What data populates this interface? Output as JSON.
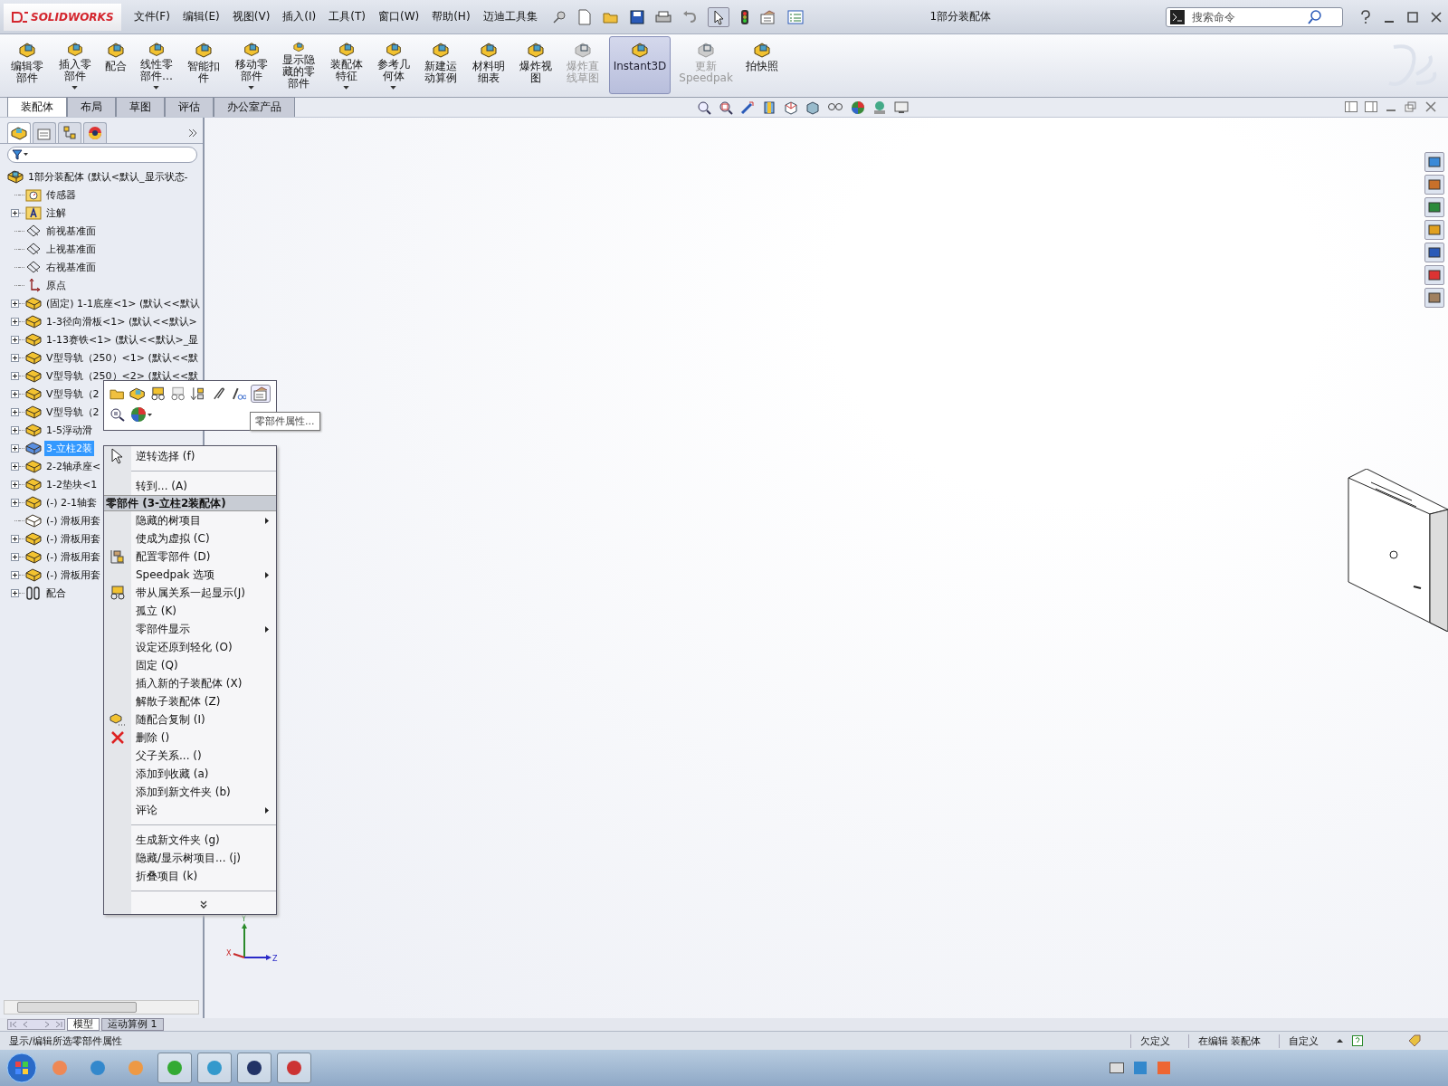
{
  "window": {
    "logo": "SOLIDWORKS",
    "title": "1部分装配体"
  },
  "menu_bar": [
    "文件(F)",
    "编辑(E)",
    "视图(V)",
    "插入(I)",
    "工具(T)",
    "窗口(W)",
    "帮助(H)",
    "迈迪工具集"
  ],
  "search": {
    "placeholder": "搜索命令"
  },
  "ribbon": [
    {
      "label": "编辑零部件",
      "dropdown": false,
      "disabled": false,
      "selected": false
    },
    {
      "label": "插入零部件",
      "dropdown": true,
      "disabled": false,
      "selected": false
    },
    {
      "label": "配合",
      "dropdown": false,
      "disabled": false,
      "selected": false
    },
    {
      "label": "线性零部件…",
      "dropdown": true,
      "disabled": false,
      "selected": false
    },
    {
      "label": "智能扣件",
      "dropdown": false,
      "disabled": false,
      "selected": false
    },
    {
      "label": "移动零部件",
      "dropdown": true,
      "disabled": false,
      "selected": false
    },
    {
      "label": "显示隐藏的零部件",
      "dropdown": false,
      "disabled": false,
      "selected": false
    },
    {
      "label": "装配体特征",
      "dropdown": true,
      "disabled": false,
      "selected": false
    },
    {
      "label": "参考几何体",
      "dropdown": true,
      "disabled": false,
      "selected": false
    },
    {
      "label": "新建运动算例",
      "dropdown": false,
      "disabled": false,
      "selected": false
    },
    {
      "label": "材料明细表",
      "dropdown": false,
      "disabled": false,
      "selected": false
    },
    {
      "label": "爆炸视图",
      "dropdown": false,
      "disabled": false,
      "selected": false
    },
    {
      "label": "爆炸直线草图",
      "dropdown": false,
      "disabled": true,
      "selected": false
    },
    {
      "label": "Instant3D",
      "dropdown": false,
      "disabled": false,
      "selected": true
    },
    {
      "label": "更新 Speedpak",
      "dropdown": false,
      "disabled": true,
      "selected": false
    },
    {
      "label": "拍快照",
      "dropdown": false,
      "disabled": false,
      "selected": false
    }
  ],
  "command_tabs": [
    {
      "label": "装配体",
      "selected": true
    },
    {
      "label": "布局",
      "selected": false
    },
    {
      "label": "草图",
      "selected": false
    },
    {
      "label": "评估",
      "selected": false
    },
    {
      "label": "办公室产品",
      "selected": false
    }
  ],
  "tree": [
    {
      "label": "1部分装配体  (默认<默认_显示状态-",
      "kind": "assembly",
      "selected": false,
      "children": [
        {
          "label": "传感器",
          "kind": "sensors",
          "selected": false
        },
        {
          "label": "注解",
          "kind": "annotations",
          "expanded": false,
          "selected": false
        },
        {
          "label": "前视基准面",
          "kind": "plane",
          "selected": false
        },
        {
          "label": "上视基准面",
          "kind": "plane",
          "selected": false
        },
        {
          "label": "右视基准面",
          "kind": "plane",
          "selected": false
        },
        {
          "label": "原点",
          "kind": "origin",
          "selected": false
        },
        {
          "label": "(固定) 1-1底座<1> (默认<<默认",
          "kind": "part",
          "expanded": false,
          "selected": false
        },
        {
          "label": "1-3径向滑板<1> (默认<<默认>",
          "kind": "part",
          "expanded": false,
          "selected": false
        },
        {
          "label": "1-13赛铁<1> (默认<<默认>_显",
          "kind": "part",
          "expanded": false,
          "selected": false
        },
        {
          "label": "V型导轨（250）<1> (默认<<默",
          "kind": "part",
          "expanded": false,
          "selected": false
        },
        {
          "label": "V型导轨（250）<2> (默认<<默",
          "kind": "part",
          "expanded": false,
          "selected": false
        },
        {
          "label": "V型导轨（2",
          "kind": "part",
          "expanded": false,
          "selected": false
        },
        {
          "label": "V型导轨（2",
          "kind": "part",
          "expanded": false,
          "selected": false
        },
        {
          "label": "1-5浮动滑",
          "kind": "part",
          "expanded": false,
          "selected": false
        },
        {
          "label": "3-立柱2装",
          "kind": "subassembly",
          "expanded": false,
          "selected": true
        },
        {
          "label": "2-2轴承座<",
          "kind": "part",
          "expanded": false,
          "selected": false
        },
        {
          "label": "1-2垫块<1",
          "kind": "part",
          "expanded": false,
          "selected": false
        },
        {
          "label": "(-) 2-1轴套",
          "kind": "part",
          "expanded": false,
          "selected": false
        },
        {
          "label": "(-) 滑板用套",
          "kind": "part-hidden",
          "selected": false
        },
        {
          "label": "(-) 滑板用套",
          "kind": "part",
          "expanded": false,
          "selected": false
        },
        {
          "label": "(-) 滑板用套",
          "kind": "part",
          "expanded": false,
          "selected": false
        },
        {
          "label": "(-) 滑板用套",
          "kind": "part",
          "expanded": false,
          "selected": false
        },
        {
          "label": "配合",
          "kind": "mates",
          "expanded": false,
          "selected": false
        }
      ]
    }
  ],
  "tooltip": "零部件属性...",
  "context_menu": [
    {
      "kind": "command",
      "label": "逆转选择 (f)",
      "submenu": false
    },
    {
      "kind": "separator"
    },
    {
      "kind": "command",
      "label": "转到... (A)",
      "submenu": false
    },
    {
      "kind": "header",
      "label": "零部件 (3-立柱2装配体)"
    },
    {
      "kind": "command",
      "label": "隐藏的树项目",
      "submenu": true
    },
    {
      "kind": "command",
      "label": "使成为虚拟 (C)",
      "submenu": false
    },
    {
      "kind": "command",
      "label": "配置零部件 (D)",
      "submenu": false
    },
    {
      "kind": "command",
      "label": "Speedpak 选项",
      "submenu": true
    },
    {
      "kind": "command",
      "label": "带从属关系一起显示(J)",
      "submenu": false
    },
    {
      "kind": "command",
      "label": "孤立 (K)",
      "submenu": false
    },
    {
      "kind": "command",
      "label": "零部件显示",
      "submenu": true
    },
    {
      "kind": "command",
      "label": "设定还原到轻化 (O)",
      "submenu": false
    },
    {
      "kind": "command",
      "label": "固定 (Q)",
      "submenu": false
    },
    {
      "kind": "command",
      "label": "插入新的子装配体 (X)",
      "submenu": false
    },
    {
      "kind": "command",
      "label": "解散子装配体 (Z)",
      "submenu": false
    },
    {
      "kind": "command",
      "label": "随配合复制 (I)",
      "submenu": false
    },
    {
      "kind": "command",
      "label": "删除 ()",
      "submenu": false
    },
    {
      "kind": "command",
      "label": "父子关系... ()",
      "submenu": false
    },
    {
      "kind": "command",
      "label": "添加到收藏 (a)",
      "submenu": false
    },
    {
      "kind": "command",
      "label": "添加到新文件夹 (b)",
      "submenu": false
    },
    {
      "kind": "command",
      "label": "评论",
      "submenu": true
    },
    {
      "kind": "separator"
    },
    {
      "kind": "command",
      "label": "生成新文件夹 (g)",
      "submenu": false
    },
    {
      "kind": "command",
      "label": "隐藏/显示树项目... (j)",
      "submenu": false
    },
    {
      "kind": "command",
      "label": "折叠项目 (k)",
      "submenu": false
    },
    {
      "kind": "separator"
    },
    {
      "kind": "more"
    }
  ],
  "triad": {
    "x": "X",
    "y": "Y",
    "z": "Z"
  },
  "bottom_tabs": [
    {
      "label": "模型",
      "selected": true
    },
    {
      "label": "运动算例 1",
      "selected": false
    }
  ],
  "status_bar": {
    "message": "显示/编辑所选零部件属性",
    "state": "欠定义",
    "mode": "在编辑 装配体",
    "units": "自定义"
  }
}
